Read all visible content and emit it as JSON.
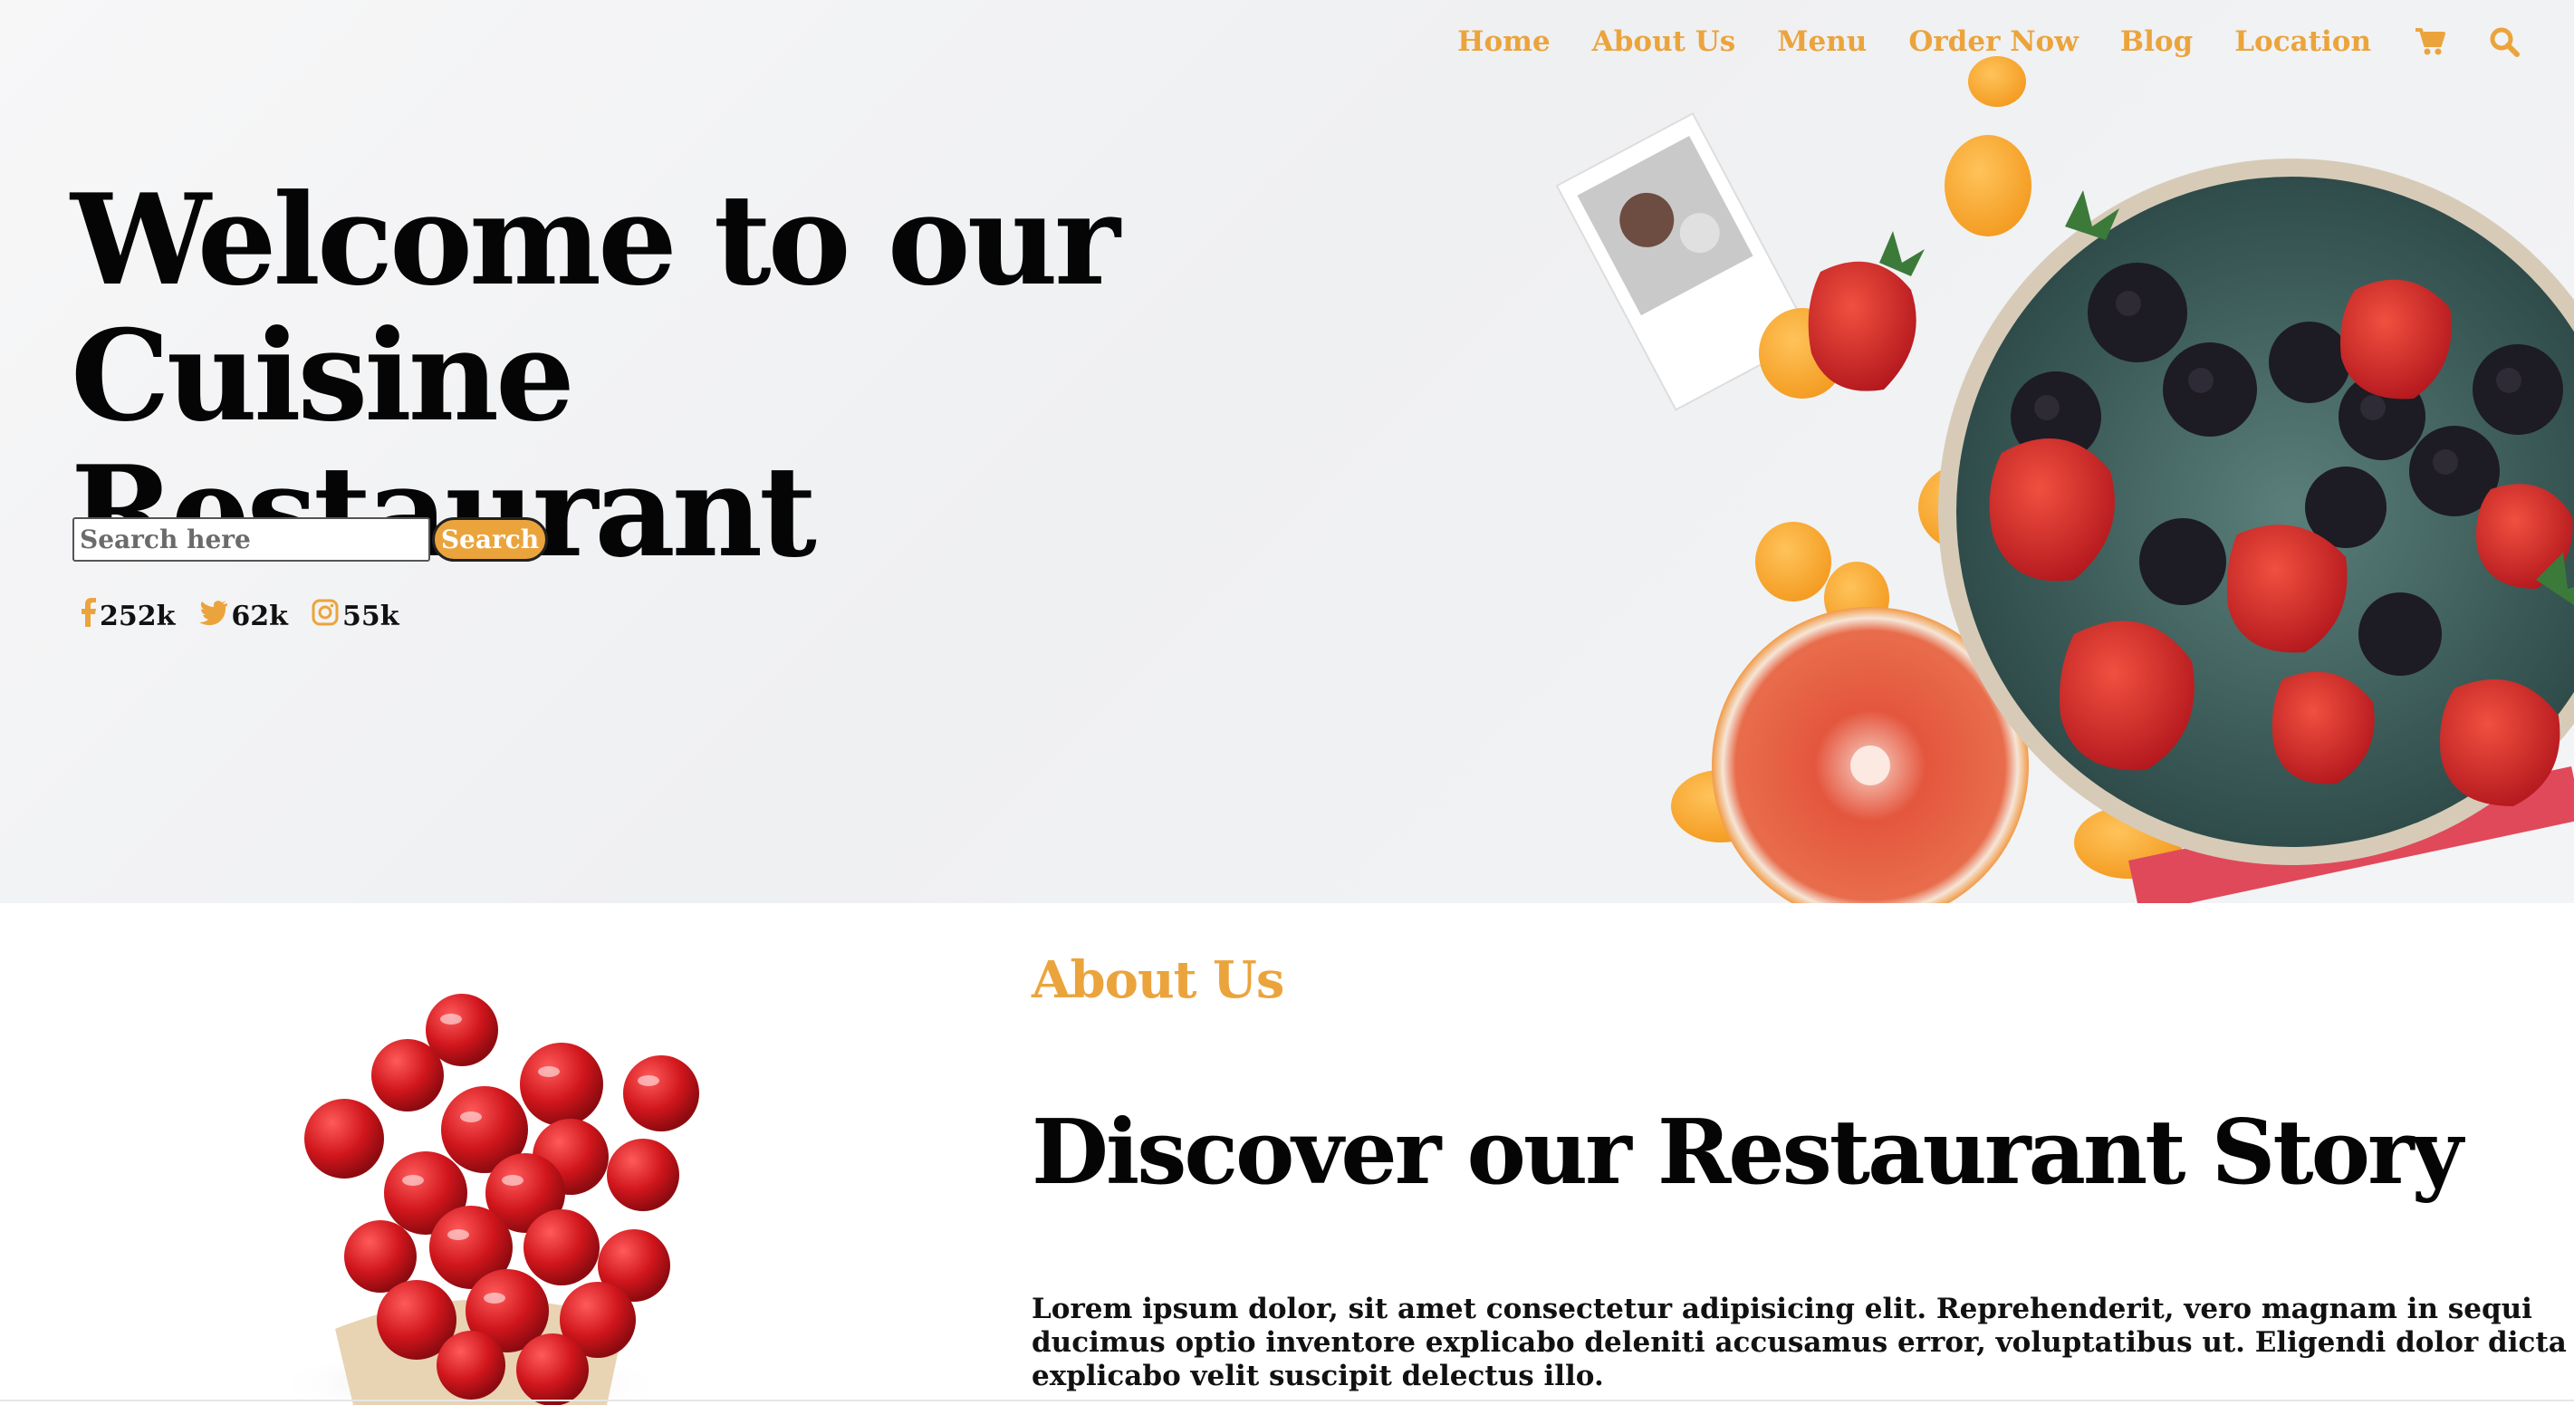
{
  "nav": {
    "items": [
      "Home",
      "About Us",
      "Menu",
      "Order Now",
      "Blog",
      "Location"
    ],
    "icons": [
      "cart-icon",
      "search-icon"
    ],
    "accent_color": "#eba43c"
  },
  "hero": {
    "title_line1": "Welcome to our Cuisine",
    "title_line2": "Restaurant",
    "search": {
      "placeholder": "Search here",
      "button_label": "Search"
    },
    "social": [
      {
        "icon": "facebook-icon",
        "count": "252k"
      },
      {
        "icon": "twitter-icon",
        "count": "62k"
      },
      {
        "icon": "instagram-icon",
        "count": "55k"
      }
    ]
  },
  "about": {
    "label": "About Us",
    "heading": "Discover our Restaurant Story",
    "paragraph": "Lorem ipsum dolor, sit amet consectetur adipisicing elit. Reprehenderit, vero magnam in sequi ducimus optio inventore explicabo deleniti accusamus error, voluptatibus ut. Eligendi dolor dicta explicabo velit suscipit delectus illo."
  }
}
